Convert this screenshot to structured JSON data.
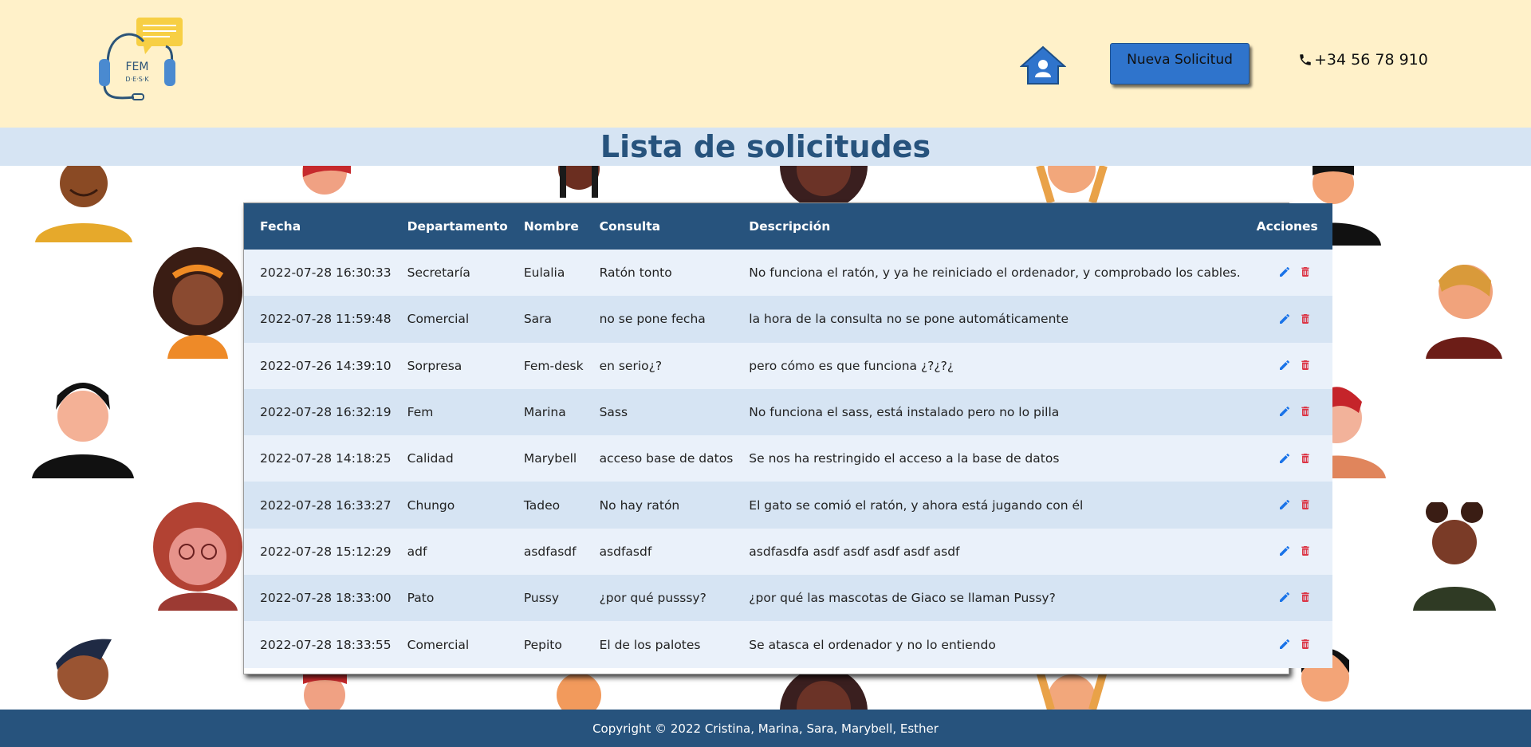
{
  "header": {
    "logo": {
      "line1": "FEM",
      "line2": "D·E·S·K"
    },
    "new_request_label": "Nueva Solicitud",
    "phone": "+34 56 78 910",
    "home_icon": "home-user-icon",
    "phone_icon": "phone-icon"
  },
  "page": {
    "title": "Lista de solicitudes"
  },
  "table": {
    "columns": [
      "Fecha",
      "Departamento",
      "Nombre",
      "Consulta",
      "Descripción",
      "Acciones"
    ],
    "rows": [
      {
        "fecha": "2022-07-28 16:30:33",
        "departamento": "Secretaría",
        "nombre": "Eulalia",
        "consulta": "Ratón tonto",
        "descripcion": "No funciona el ratón, y ya he reiniciado el ordenador, y comprobado los cables."
      },
      {
        "fecha": "2022-07-28 11:59:48",
        "departamento": "Comercial",
        "nombre": "Sara",
        "consulta": "no se pone fecha",
        "descripcion": "la hora de la consulta no se pone automáticamente"
      },
      {
        "fecha": "2022-07-26 14:39:10",
        "departamento": "Sorpresa",
        "nombre": "Fem-desk",
        "consulta": "en serio¿?",
        "descripcion": "pero cómo es que funciona ¿?¿?¿"
      },
      {
        "fecha": "2022-07-28 16:32:19",
        "departamento": "Fem",
        "nombre": "Marina",
        "consulta": "Sass",
        "descripcion": "No funciona el sass, está instalado pero no lo pilla"
      },
      {
        "fecha": "2022-07-28 14:18:25",
        "departamento": "Calidad",
        "nombre": "Marybell",
        "consulta": "acceso base de datos",
        "descripcion": "Se nos ha restringido el acceso a la base de datos"
      },
      {
        "fecha": "2022-07-28 16:33:27",
        "departamento": "Chungo",
        "nombre": "Tadeo",
        "consulta": "No hay ratón",
        "descripcion": "El gato se comió el ratón, y ahora está jugando con él"
      },
      {
        "fecha": "2022-07-28 15:12:29",
        "departamento": "adf",
        "nombre": "asdfasdf",
        "consulta": "asdfasdf",
        "descripcion": "asdfasdfa asdf asdf asdf asdf asdf"
      },
      {
        "fecha": "2022-07-28 18:33:00",
        "departamento": "Pato",
        "nombre": "Pussy",
        "consulta": "¿por qué pusssy?",
        "descripcion": "¿por qué las mascotas de Giaco se llaman Pussy?"
      },
      {
        "fecha": "2022-07-28 18:33:55",
        "departamento": "Comercial",
        "nombre": "Pepito",
        "consulta": "El de los palotes",
        "descripcion": "Se atasca el ordenador y no lo entiendo"
      }
    ],
    "actions": {
      "edit_icon": "pencil-icon",
      "delete_icon": "trash-icon",
      "edit_color": "#1a73e8",
      "delete_color": "#dc3545"
    }
  },
  "footer": {
    "copyright": "Copyright © 2022 Cristina, Marina, Sara, Marybell, Esther"
  },
  "colors": {
    "header_bg": "#fff1c9",
    "band_bg": "#d6e4f3",
    "primary": "#27537d",
    "button": "#2f74cc"
  }
}
